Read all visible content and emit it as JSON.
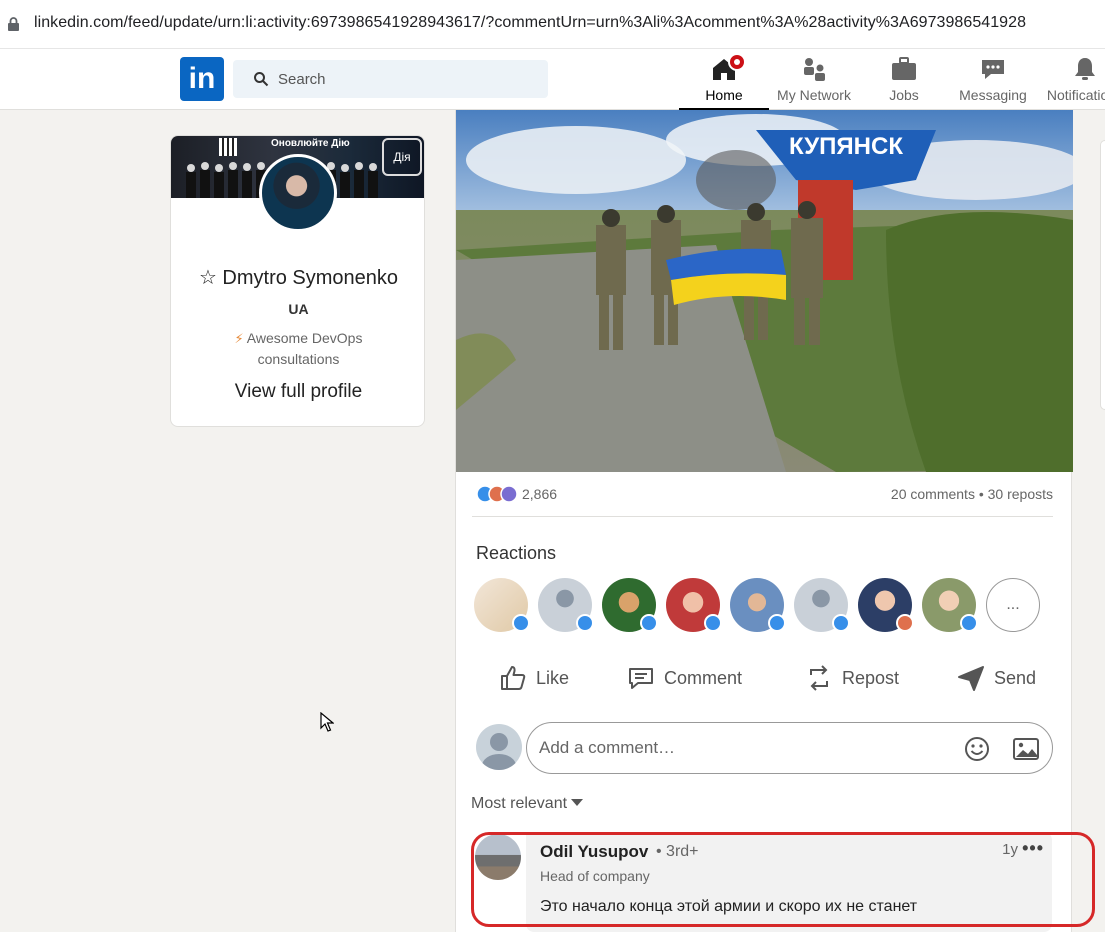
{
  "browser": {
    "url": "linkedin.com/feed/update/urn:li:activity:6973986541928943617/?commentUrn=urn%3Ali%3Acomment%3A%28activity%3A6973986541928"
  },
  "nav": {
    "logo": "in",
    "search_placeholder": "Search",
    "items": [
      {
        "label": "Home",
        "icon": "home-icon",
        "active": true
      },
      {
        "label": "My Network",
        "icon": "my-network-icon"
      },
      {
        "label": "Jobs",
        "icon": "briefcase-icon"
      },
      {
        "label": "Messaging",
        "icon": "messaging-icon"
      },
      {
        "label": "Notifications",
        "icon": "bell-icon"
      }
    ]
  },
  "profile": {
    "name": "☆ Dmytro Symonenko",
    "location": "UA",
    "headline": "Awesome DevOps consultations",
    "view_profile": "View full profile",
    "banner_text": "Оновлюйте Дію",
    "banner_brand": "Дія"
  },
  "post": {
    "photo_sign": "КУПЯНСК",
    "reaction_count": "2,866",
    "comments_reposts": "20 comments • 30 reposts",
    "reactions_title": "Reactions",
    "reaction_more": "...",
    "actions": {
      "like": "Like",
      "comment": "Comment",
      "repost": "Repost",
      "send": "Send"
    },
    "comment_placeholder": "Add a comment…",
    "sort_label": "Most relevant",
    "colors": {
      "brand": "#0a66c2",
      "highlight": "#d62828"
    }
  },
  "comment": {
    "author": "Odil Yusupov",
    "degree": "• 3rd+",
    "time": "1y",
    "title": "Head of company",
    "text": "Это начало конца этой армии и скоро их не станет",
    "menu": "•••"
  }
}
